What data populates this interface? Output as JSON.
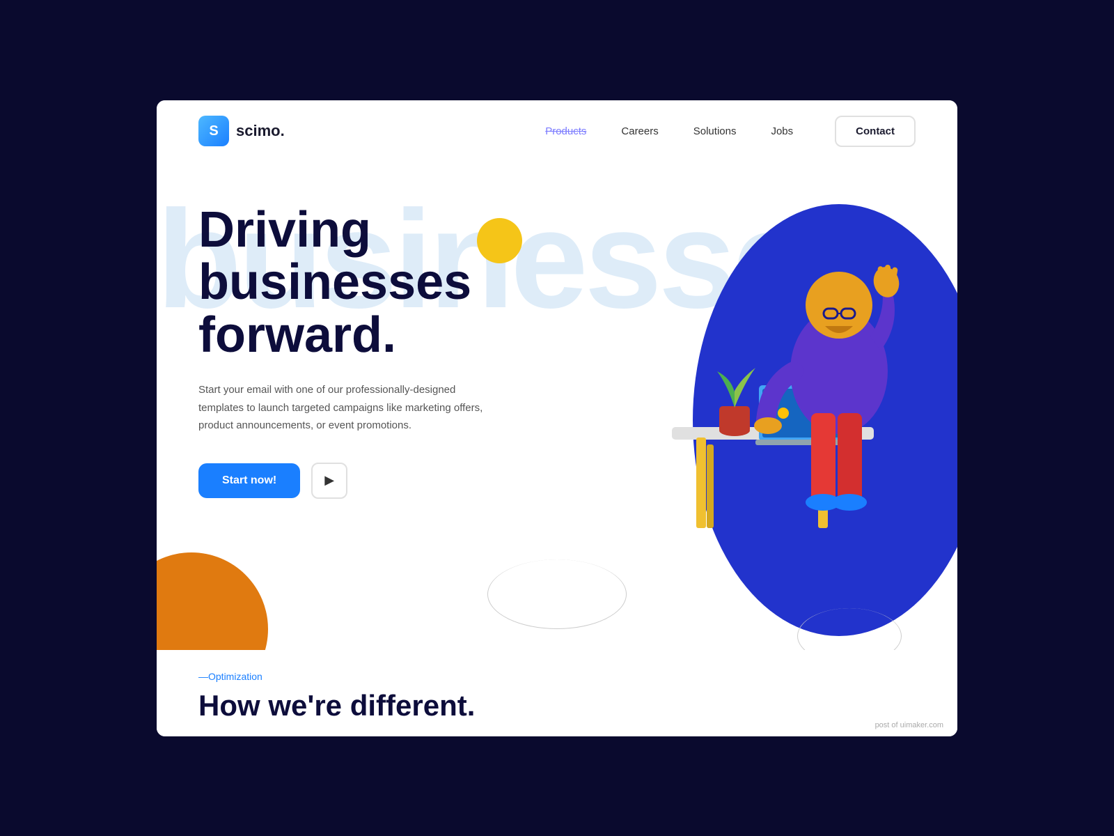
{
  "site": {
    "logo_icon": "S",
    "logo_name": "scimo."
  },
  "nav": {
    "links": [
      {
        "label": "Products",
        "active": true
      },
      {
        "label": "Careers",
        "active": false
      },
      {
        "label": "Solutions",
        "active": false
      },
      {
        "label": "Jobs",
        "active": false
      }
    ],
    "contact_label": "Contact"
  },
  "hero": {
    "bg_text": "businesses",
    "title_line1": "Driving",
    "title_line2": "businesses",
    "title_line3": "forward.",
    "subtitle": "Start your email with one of our professionally-designed templates to launch targeted campaigns like marketing offers, product announcements, or event promotions.",
    "start_btn": "Start now!",
    "play_btn": "▶"
  },
  "bottom": {
    "optimization_prefix": "—",
    "optimization_label": "Optimization",
    "how_title": "How we're different."
  },
  "watermark": "post of uimaker.com"
}
